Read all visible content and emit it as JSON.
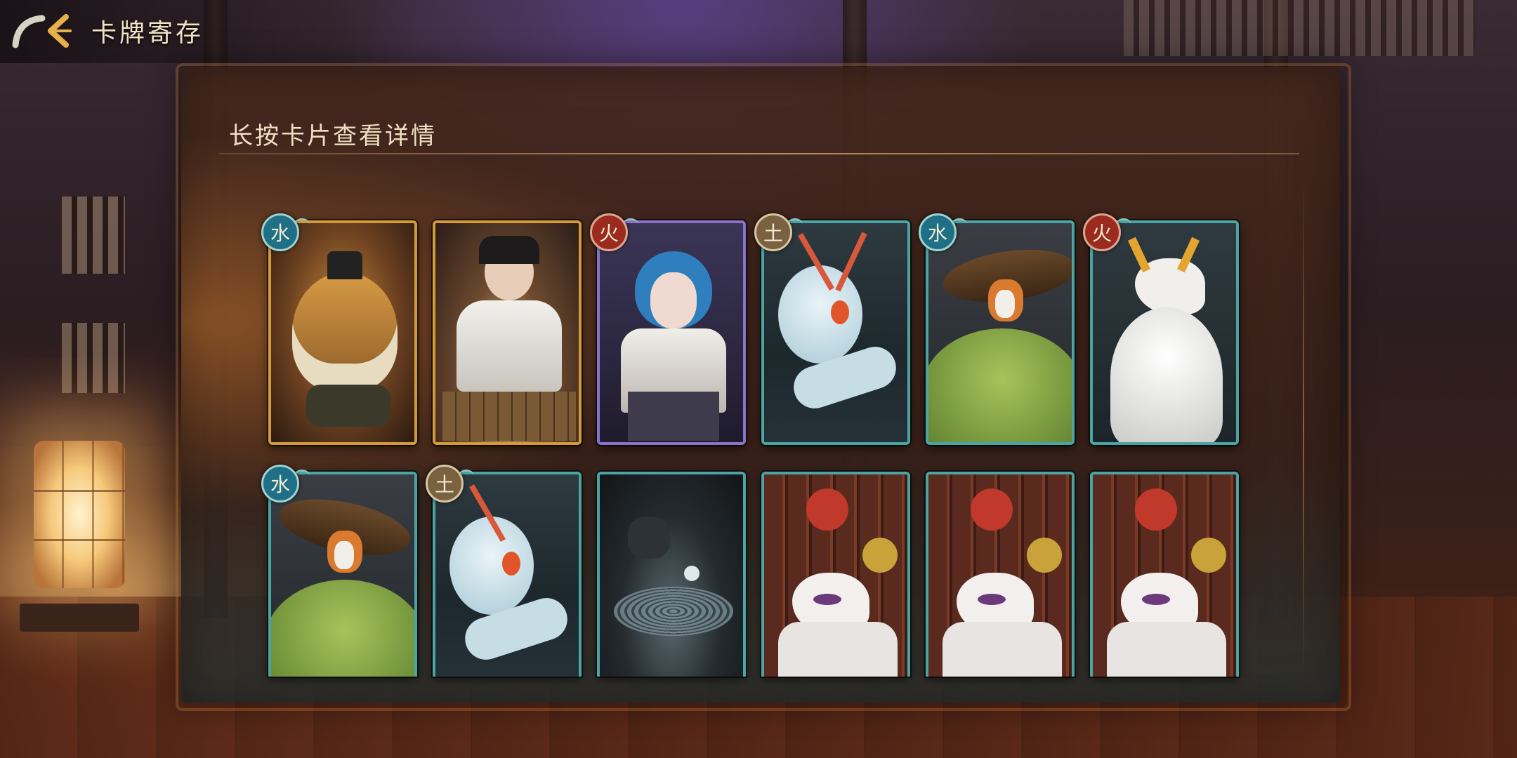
{
  "header": {
    "title": "卡牌寄存",
    "back_icon": "back-arrow-icon"
  },
  "panel": {
    "hint": "长按卡片查看详情"
  },
  "elements": {
    "water": {
      "label": "水",
      "color": "#1f6f86"
    },
    "fire": {
      "label": "火",
      "color": "#9a2b1e"
    },
    "earth": {
      "label": "土",
      "color": "#7a6140"
    }
  },
  "cards": [
    {
      "row": 1,
      "element": "水",
      "frame": "gold",
      "art": "tiger-catfish-yokai"
    },
    {
      "row": 1,
      "element": "",
      "frame": "gold",
      "art": "go-player-onmyoji"
    },
    {
      "row": 1,
      "element": "火",
      "frame": "purple",
      "art": "blue-haired-girl"
    },
    {
      "row": 1,
      "element": "土",
      "frame": "teal",
      "art": "white-eel-spirit"
    },
    {
      "row": 1,
      "element": "水",
      "frame": "teal",
      "art": "turtle-with-hat-rider"
    },
    {
      "row": 1,
      "element": "火",
      "frame": "teal",
      "art": "white-fox-spirit"
    },
    {
      "row": 2,
      "element": "水",
      "frame": "teal",
      "art": "turtle-with-hat-rider"
    },
    {
      "row": 2,
      "element": "土",
      "frame": "teal",
      "art": "white-eel-spirit"
    },
    {
      "row": 2,
      "element": "",
      "frame": "teal",
      "art": "dark-go-board-scene"
    },
    {
      "row": 2,
      "element": "",
      "frame": "teal",
      "art": "fox-mask-stage"
    },
    {
      "row": 2,
      "element": "",
      "frame": "teal",
      "art": "fox-mask-stage"
    },
    {
      "row": 2,
      "element": "",
      "frame": "teal",
      "art": "fox-mask-stage"
    }
  ]
}
